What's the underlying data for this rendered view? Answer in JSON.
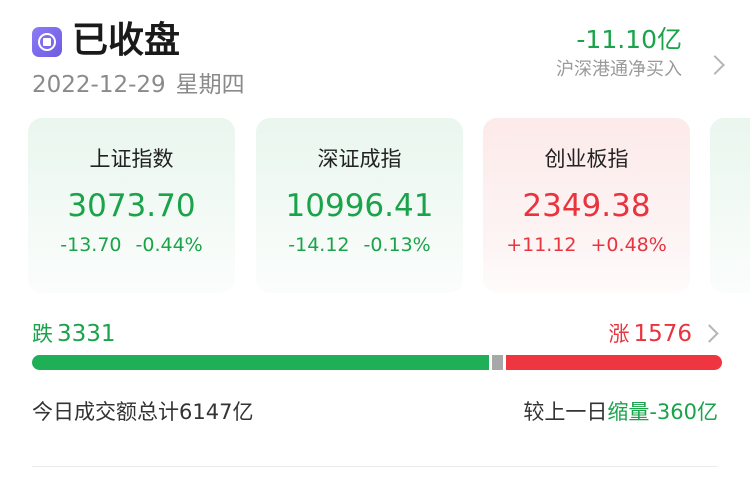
{
  "header": {
    "status_title": "已收盘",
    "date": "2022-12-29",
    "weekday": "星期四",
    "status_icon": "market-closed-icon"
  },
  "northbound": {
    "value": "-11.10亿",
    "label": "沪深港通净买入"
  },
  "indices": [
    {
      "name": "上证指数",
      "value": "3073.70",
      "change": "-13.70",
      "change_pct": "-0.44%",
      "trend": "down"
    },
    {
      "name": "深证成指",
      "value": "10996.41",
      "change": "-14.12",
      "change_pct": "-0.13%",
      "trend": "down"
    },
    {
      "name": "创业板指",
      "value": "2349.38",
      "change": "+11.12",
      "change_pct": "+0.48%",
      "trend": "up"
    }
  ],
  "breadth": {
    "fall_label": "跌",
    "fall_count": "3331",
    "rise_label": "涨",
    "rise_count": "1576",
    "flat_count": 81
  },
  "volume": {
    "total_text": "今日成交额总计6147亿",
    "compare_prefix": "较上一日",
    "compare_change": "缩量-360亿"
  },
  "colors": {
    "up": "#e8343f",
    "down": "#1aa34a",
    "accent": "#6d5be0"
  }
}
